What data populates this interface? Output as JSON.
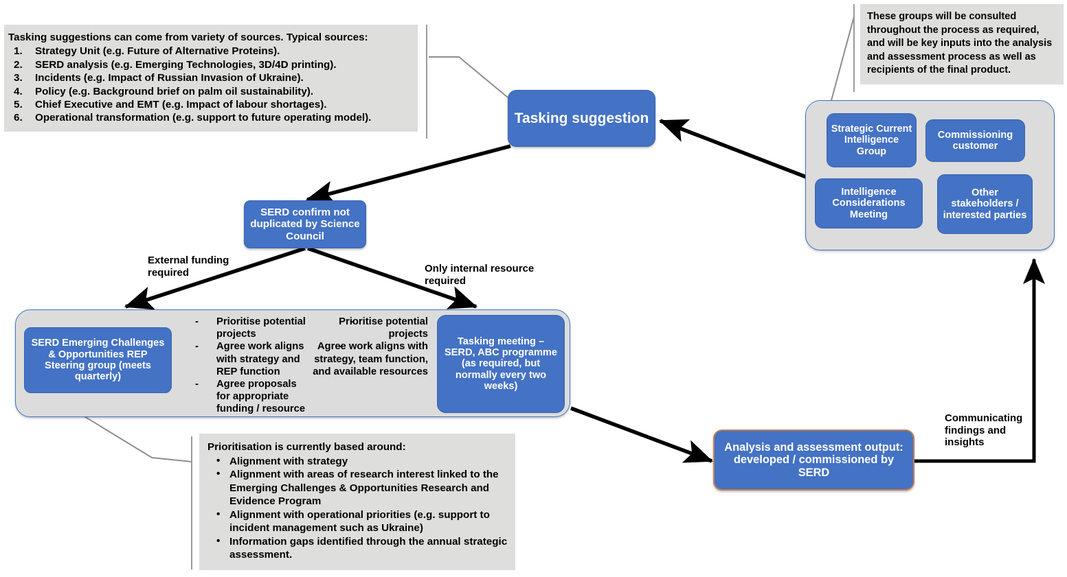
{
  "colors": {
    "node_blue": "#4472c4",
    "panel_grey": "#dcdcdc",
    "note_grey": "#dededc",
    "accent_orange": "#c5804f",
    "edge_black": "#000000",
    "leader_grey": "#9a9a9a"
  },
  "notes": {
    "sources": {
      "title": "Tasking suggestions can come from variety of sources. Typical sources:",
      "items": [
        {
          "num": "1.",
          "text": "Strategy Unit (e.g. Future of Alternative Proteins)."
        },
        {
          "num": "2.",
          "text": "SERD analysis (e.g. Emerging Technologies, 3D/4D printing)."
        },
        {
          "num": "3.",
          "text": "Incidents (e.g. Impact of Russian Invasion of Ukraine)."
        },
        {
          "num": "4.",
          "text": "Policy (e.g. Background brief on palm oil sustainability)."
        },
        {
          "num": "5.",
          "text": "Chief Executive and EMT (e.g. Impact of labour shortages)."
        },
        {
          "num": "6.",
          "text": "Operational transformation (e.g. support to future operating model)."
        }
      ]
    },
    "consulted": {
      "text": "These groups will  be consulted throughout the process as required, and will  be key inputs into the analysis and assessment process as well  as recipients of the final product."
    },
    "prioritisation": {
      "title": "Prioritisation is currently based around:",
      "items": [
        "Alignment with  strategy",
        "Alignment with  areas of research interest linked to the Emerging Challenges & Opportunities Research and Evidence Program",
        "Alignment with operational priorities (e.g. support to incident management such as Ukraine)",
        "Information gaps identified through the annual strategic assessment."
      ]
    }
  },
  "nodes": {
    "tasking_suggestion": "Tasking suggestion",
    "serd_confirm": "SERD confirm not duplicated by Science Council",
    "serd_steering": "SERD Emerging Challenges & Opportunities REP Steering group (meets quarterly)",
    "tasking_meeting": "Tasking meeting – SERD, ABC programme (as required, but normally every two weeks)",
    "analysis_output": "Analysis and assessment output: developed / commissioned by SERD"
  },
  "stakeholders": {
    "boxes": [
      "Strategic Current Intelligence Group",
      "Commissioning customer",
      "Intelligence Considerations Meeting",
      "Other stakeholders / interested parties"
    ]
  },
  "bullets": {
    "left_branch": [
      "Prioritise potential projects",
      "Agree work aligns with strategy and REP function",
      "Agree proposals for appropriate funding / resource"
    ],
    "right_branch": [
      "Prioritise potential projects",
      "Agree work aligns with strategy, team function, and available resources"
    ],
    "marker": "-"
  },
  "edge_labels": {
    "external_funding": "External funding required",
    "only_internal": "Only internal resource required",
    "communicating": "Communicating findings and insights"
  }
}
